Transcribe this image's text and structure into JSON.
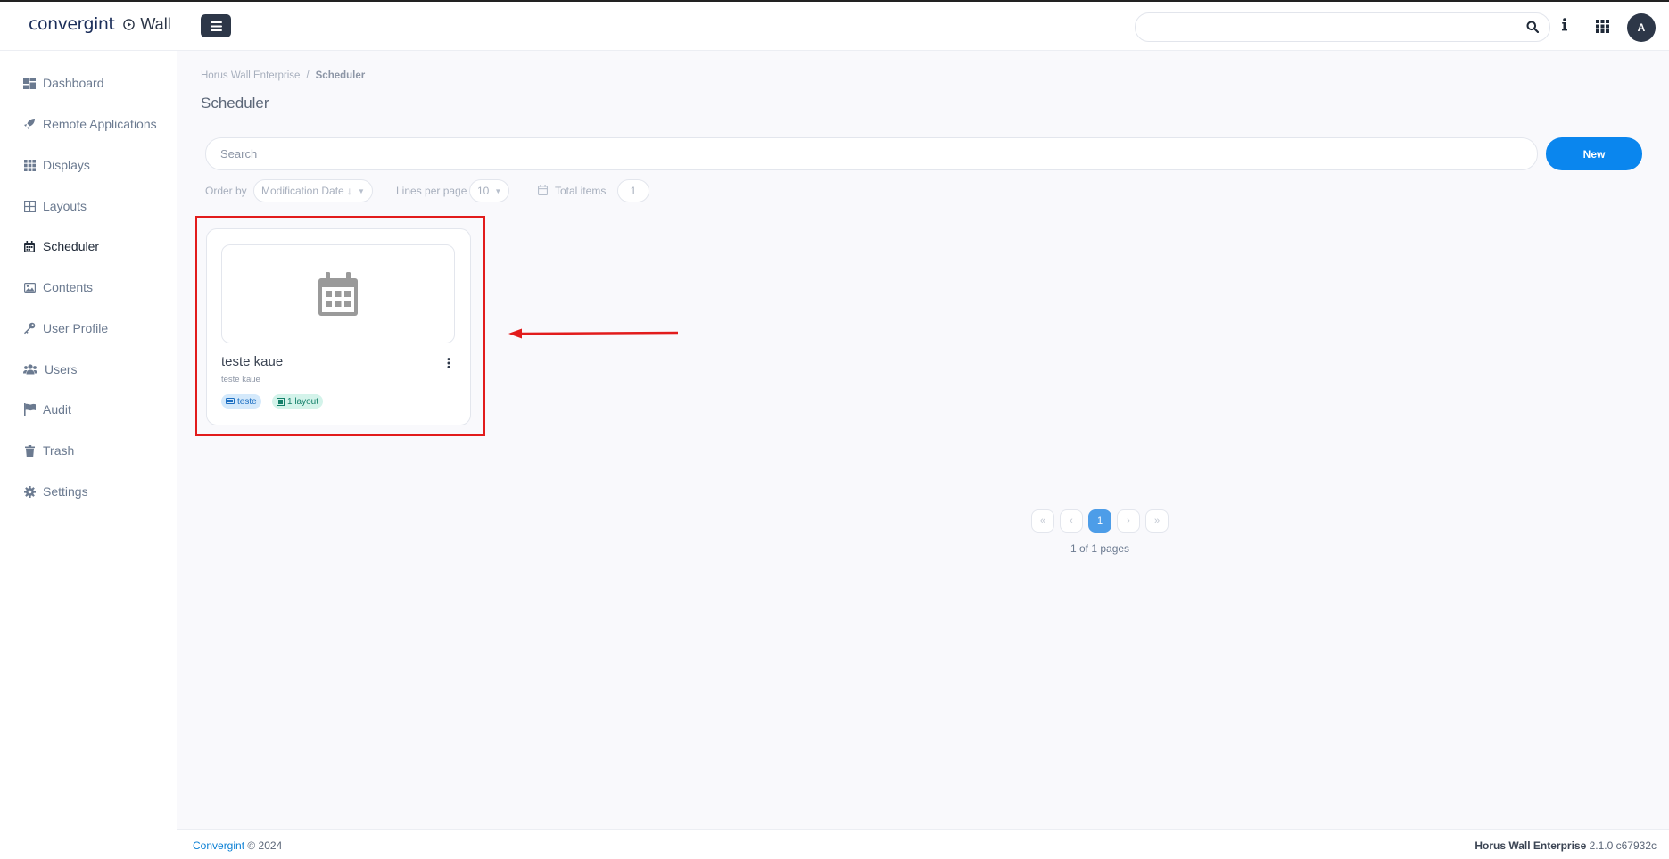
{
  "header": {
    "brand": "convergint",
    "app_name": "Wall",
    "search": {
      "value": "",
      "placeholder": ""
    },
    "avatar_initial": "A"
  },
  "sidebar": {
    "items": [
      {
        "label": "Dashboard",
        "icon": "dashboard-icon"
      },
      {
        "label": "Remote Applications",
        "icon": "rocket-icon"
      },
      {
        "label": "Displays",
        "icon": "grid-icon"
      },
      {
        "label": "Layouts",
        "icon": "layout-icon"
      },
      {
        "label": "Scheduler",
        "icon": "calendar-icon",
        "active": true
      },
      {
        "label": "Contents",
        "icon": "image-icon"
      },
      {
        "label": "User Profile",
        "icon": "key-icon"
      },
      {
        "label": "Users",
        "icon": "users-icon"
      },
      {
        "label": "Audit",
        "icon": "flag-icon"
      },
      {
        "label": "Trash",
        "icon": "trash-icon"
      },
      {
        "label": "Settings",
        "icon": "gear-icon"
      }
    ]
  },
  "breadcrumb": {
    "root": "Horus Wall Enterprise",
    "separator": "/",
    "current": "Scheduler"
  },
  "page_title": "Scheduler",
  "search": {
    "placeholder": "Search",
    "value": ""
  },
  "new_button": "New",
  "filters": {
    "order_by_label": "Order by",
    "order_by_value": "Modification Date ↓",
    "lines_per_page_label": "Lines per page",
    "lines_per_page_value": "10",
    "total_items_label": "Total items",
    "total_items_value": "1"
  },
  "cards": [
    {
      "title": "teste kaue",
      "subtitle": "teste kaue",
      "tags": [
        {
          "label": "teste",
          "color": "#d4e9fb"
        },
        {
          "label": "1 layout",
          "color": "#d3f3ea"
        }
      ]
    }
  ],
  "pagination": {
    "first": "«",
    "prev": "‹",
    "current": "1",
    "next": "›",
    "last": "»",
    "summary": "1 of 1 pages"
  },
  "footer": {
    "company": "Convergint",
    "copyright": "© 2024",
    "product": "Horus Wall Enterprise",
    "version": "2.1.0 c67932c"
  },
  "colors": {
    "primary": "#0a86ee",
    "sidebar_dark": "#2d3748",
    "highlight": "#e21c1c"
  }
}
